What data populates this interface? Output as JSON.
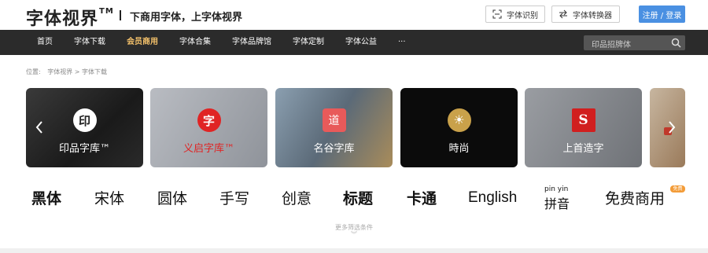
{
  "header": {
    "logo_text": "字体视界",
    "logo_tm": "TM",
    "slogan": "下商用字体，上字体视界",
    "recognize_label": "字体识别",
    "convert_label": "字体转换器",
    "login_label": "注册 / 登录"
  },
  "nav": {
    "items": [
      "首页",
      "字体下载",
      "会员商用",
      "字体合集",
      "字体品牌馆",
      "字体定制",
      "字体公益",
      "···"
    ],
    "active_index": 2,
    "search_placeholder": "印品招牌体"
  },
  "breadcrumb": {
    "prefix": "位置:",
    "path": "字体视界 > 字体下载"
  },
  "carousel": {
    "cards": [
      {
        "title": "印品字库™",
        "badge": "印"
      },
      {
        "title": "义启字库™",
        "badge": "字"
      },
      {
        "title": "名谷字库",
        "badge": "道"
      },
      {
        "title": "時尚",
        "badge": "☀"
      },
      {
        "title": "上首造字",
        "badge": "S"
      },
      {
        "title": "",
        "badge": ""
      }
    ]
  },
  "categories": {
    "items": [
      "黑体",
      "宋体",
      "圆体",
      "手写",
      "创意",
      "标题",
      "卡通",
      "English"
    ],
    "pinyin_top": "pin  yin",
    "pinyin_bottom": "拼音",
    "free_commercial": "免费商用",
    "free_tag": "免费",
    "more_label": "更多筛选条件"
  },
  "colors": {
    "nav_bg": "#2b2b2b",
    "nav_active": "#f5c26b",
    "login_bg": "#4a90e2",
    "free_tag_bg": "#f39c38"
  }
}
